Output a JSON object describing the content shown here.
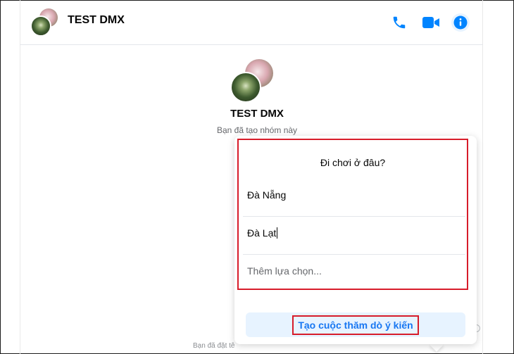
{
  "header": {
    "title": "TEST DMX",
    "icons": [
      "phone-icon",
      "video-camera-icon",
      "info-icon"
    ],
    "accent_color": "#0084ff"
  },
  "conversation": {
    "group_name": "TEST DMX",
    "subtitle": "Bạn đã tạo nhóm này",
    "bottom_hint": "Bạn đã đặt tê"
  },
  "poll": {
    "question": "Đi chơi ở đâu?",
    "options": [
      "Đà Nẵng",
      "Đà Lạt"
    ],
    "add_option_placeholder": "Thêm lựa chọn...",
    "create_button_label": "Tạo cuộc thăm dò ý kiến",
    "highlight_color": "#d71c2a"
  }
}
